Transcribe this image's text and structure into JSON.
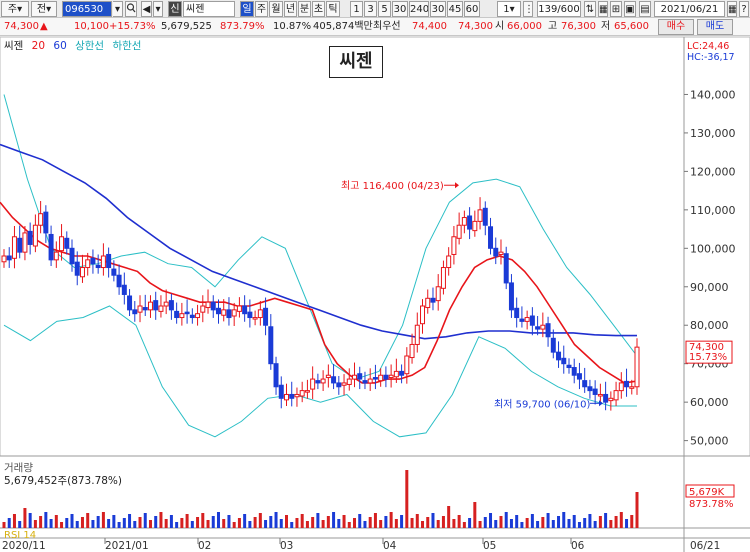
{
  "toolbar": {
    "period": "주",
    "jeon": "전",
    "code": "096530",
    "sin": "신",
    "name": "씨젠",
    "periods": [
      "일",
      "주",
      "월",
      "년",
      "분",
      "초",
      "틱"
    ],
    "intervals": [
      "1",
      "3",
      "5",
      "30",
      "240",
      "30",
      "45",
      "60"
    ],
    "count_select": "1",
    "pages": "139/600",
    "date": "2021/06/21"
  },
  "quote": {
    "price": "74,300",
    "arrow": "▲",
    "change": "10,100",
    "pct": "+15.73%",
    "volume": "5,679,525",
    "vol_pct": "873.79%",
    "turnover": "10.87%",
    "amount": "405,874백만",
    "pref_label": "최우선",
    "pref_ask": "74,400",
    "pref_bid": "74,300",
    "open_label": "시",
    "open": "66,000",
    "high_label": "고",
    "high": "76,300",
    "low_label": "저",
    "low": "65,600",
    "buy": "매수",
    "sell": "매도"
  },
  "legend": {
    "name": "씨젠",
    "ma20": "20",
    "ma60": "60",
    "upper": "상한선",
    "lower": "하한선"
  },
  "chart_title": "씨젠",
  "side": {
    "lc": "LC:24,46",
    "hc": "HC:-36,17"
  },
  "volume_panel": {
    "title": "거래량",
    "value": "5,679,452주(873.78%)",
    "side_value": "5,679K",
    "side_pct": "873.78%"
  },
  "rsi_label": "RSI 14",
  "colors": {
    "up": "#e8151a",
    "down": "#1a3bd6",
    "ma20": "#e8151a",
    "ma60": "#1f2fcf",
    "band": "#2cbfc6",
    "vol": "#d62020",
    "vol_down": "#1a3bd6"
  },
  "chart_data": {
    "type": "candlestick",
    "title": "씨젠",
    "ylim": [
      46000,
      150000
    ],
    "y_ticks": [
      50000,
      60000,
      70000,
      80000,
      90000,
      100000,
      110000,
      120000,
      130000,
      140000
    ],
    "y_tick_labels": [
      "50,000",
      "60,000",
      "70,000",
      "80,000",
      "90,000",
      "100,000",
      "110,000",
      "120,000",
      "130,000",
      "140,000"
    ],
    "x_tick_labels": [
      "2020/11",
      "2021/01",
      "02",
      "03",
      "04",
      "05",
      "06",
      "06/21"
    ],
    "annotations": [
      {
        "text": "최고 116,400 (04/23)",
        "value": 116400
      },
      {
        "text": "최저 59,700 (06/10)",
        "value": 59700
      }
    ],
    "last_price": {
      "value": "74,300",
      "pct": "15.73%"
    },
    "close_approx": [
      98000,
      97000,
      103000,
      99000,
      104000,
      101000,
      106000,
      109000,
      104000,
      97000,
      99000,
      103000,
      100000,
      96000,
      93000,
      95000,
      97000,
      96000,
      95000,
      98000,
      95000,
      93000,
      90000,
      88000,
      84000,
      83000,
      85000,
      84000,
      86000,
      84000,
      85000,
      86000,
      84000,
      82000,
      83000,
      83000,
      82000,
      83000,
      85000,
      86000,
      84000,
      83000,
      84000,
      82000,
      84000,
      85000,
      83000,
      82000,
      82000,
      84000,
      80000,
      70000,
      64000,
      61000,
      62000,
      61000,
      62000,
      63000,
      63000,
      66000,
      65000,
      66000,
      67000,
      65000,
      64000,
      65000,
      66000,
      67000,
      66000,
      65000,
      66000,
      66000,
      67000,
      66000,
      67000,
      68000,
      67000,
      72000,
      75000,
      80000,
      85000,
      87000,
      86000,
      90000,
      95000,
      98000,
      103000,
      106000,
      108000,
      105000,
      107000,
      110000,
      106000,
      100000,
      98000,
      99000,
      91000,
      84000,
      82000,
      81000,
      82000,
      80000,
      79000,
      80000,
      77000,
      73000,
      71000,
      70000,
      69000,
      67000,
      66000,
      64000,
      63000,
      62000,
      62000,
      60000,
      61000,
      63000,
      65000,
      64000,
      64000,
      74300
    ],
    "ma20_approx": [
      112000,
      108000,
      105000,
      102000,
      100000,
      99000,
      98000,
      98000,
      97000,
      96000,
      95000,
      94000,
      91000,
      89000,
      88000,
      87000,
      86000,
      86000,
      86000,
      85000,
      85000,
      86000,
      87000,
      86000,
      85000,
      84000,
      75000,
      70000,
      67000,
      65000,
      65000,
      66000,
      66000,
      67000,
      69000,
      76000,
      84000,
      90000,
      95000,
      97000,
      98000,
      97000,
      94000,
      90000,
      85000,
      80000,
      75000,
      72000,
      69000,
      67000,
      65000,
      65500
    ],
    "ma60_approx": [
      127000,
      125000,
      123000,
      120000,
      117000,
      113000,
      108000,
      104000,
      100000,
      97000,
      94000,
      92000,
      90000,
      88000,
      86000,
      84000,
      82000,
      80000,
      78500,
      77500,
      76500,
      77000,
      78000,
      78500,
      78500,
      78000,
      78000,
      78000,
      77500,
      77300,
      77300
    ],
    "upper_band_approx": [
      140000,
      118000,
      100000,
      95000,
      96000,
      98000,
      99000,
      96000,
      95000,
      90000,
      97000,
      103000,
      100000,
      85000,
      70000,
      66000,
      68000,
      80000,
      100000,
      112000,
      117000,
      118000,
      116000,
      105000,
      95000,
      88000,
      80000,
      72000
    ],
    "lower_band_approx": [
      80000,
      76000,
      81000,
      82000,
      85000,
      80000,
      64000,
      54000,
      51000,
      55000,
      61000,
      62000,
      60000,
      62000,
      55000,
      51000,
      52000,
      62000,
      77000,
      74000,
      68000,
      64000,
      61000,
      59000,
      59000
    ]
  }
}
